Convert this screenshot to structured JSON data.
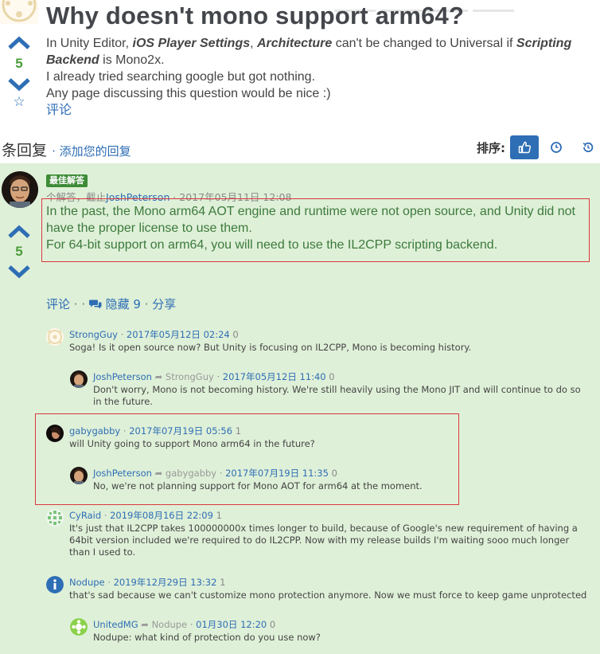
{
  "question": {
    "title": "Why doesn't mono support arm64?",
    "votes": "5",
    "body_prefix": "In Unity Editor, ",
    "body_em1": "iOS Player Settings",
    "body_mid1": ", ",
    "body_em2": "Architecture",
    "body_mid2": " can't be changed to Universal if ",
    "body_em3": "Scripting Backend",
    "body_suffix": " is Mono2x.",
    "line2": "I already tried searching google but got nothing.",
    "line3": "Any page discussing this question would be nice :)",
    "comments_link": "评论"
  },
  "answers_bar": {
    "count_label": "条回复",
    "add_answer": "· 添加您的回复",
    "sort_label": "排序:"
  },
  "answer": {
    "best_badge": "最佳解答",
    "meta_prefix": "个解答，截止",
    "meta_user": "JoshPeterson",
    "meta_date": " · 2017年05月11日 12:08",
    "votes": "5",
    "body_line1": "In the past, the Mono arm64 AOT engine and runtime were not open source, and Unity did not have the proper license to use them.",
    "body_line2": "For 64-bit support on arm64, you will need to use the IL2CPP scripting backend.",
    "actions": {
      "comment": "评论",
      "sep1": " · · ",
      "hide": "隐藏 9",
      "sep2": " · ",
      "share": "分享"
    }
  },
  "comments": [
    {
      "user": "StrongGuy",
      "reply_to": "",
      "date": "2017年05月12日 02:24",
      "votes": "0",
      "text": "Soga! Is it open source now? But Unity is focusing on IL2CPP, Mono is becoming history."
    },
    {
      "user": "JoshPeterson",
      "reply_to": "StrongGuy",
      "date": "2017年05月12日 11:40",
      "votes": "0",
      "text": "Don't worry, Mono is not becoming history. We're still heavily using the Mono JIT and will continue to do so in the future."
    },
    {
      "user": "gabygabby",
      "reply_to": "",
      "date": "2017年07月19日 05:56",
      "votes": "1",
      "text": "will Unity going to support Mono arm64 in the future?"
    },
    {
      "user": "JoshPeterson",
      "reply_to": "gabygabby",
      "date": "2017年07月19日 11:35",
      "votes": "0",
      "text": "No, we're not planning support for Mono AOT for arm64 at the moment."
    },
    {
      "user": "CyRaid",
      "reply_to": "",
      "date": "2019年08月16日 22:09",
      "votes": "1",
      "text": "It's just that IL2CPP takes 100000000x times longer to build, because of Google's new requirement of having a 64bit version included we're required to do IL2CPP. Now with my release builds I'm waiting sooo much longer than I used to."
    },
    {
      "user": "Nodupe",
      "reply_to": "",
      "date": "2019年12月29日 13:32",
      "votes": "1",
      "text": "that's sad because we can't customize mono protection anymore. Now we must force to keep game unprotected"
    },
    {
      "user": "UnitedMG",
      "reply_to": "Nodupe",
      "date": "01月30日 12:20",
      "votes": "0",
      "text": "Nodupe: what kind of protection do you use now?"
    }
  ],
  "icons": {
    "vote_up": "chevron-up-icon",
    "vote_down": "chevron-down-icon",
    "favorite": "star-outline-icon",
    "sort_votes": "thumbs-up-icon",
    "sort_newest": "clock-icon",
    "sort_activity": "history-icon",
    "comments": "speech-bubbles-icon",
    "reply": "reply-arrow-icon"
  },
  "colors": {
    "link": "#2e6eb5",
    "accepted_bg": "#dff0d8",
    "accepted_text": "#3c7a3c",
    "highlight_box": "#d9383e",
    "vote_count": "#4a9c3a"
  }
}
